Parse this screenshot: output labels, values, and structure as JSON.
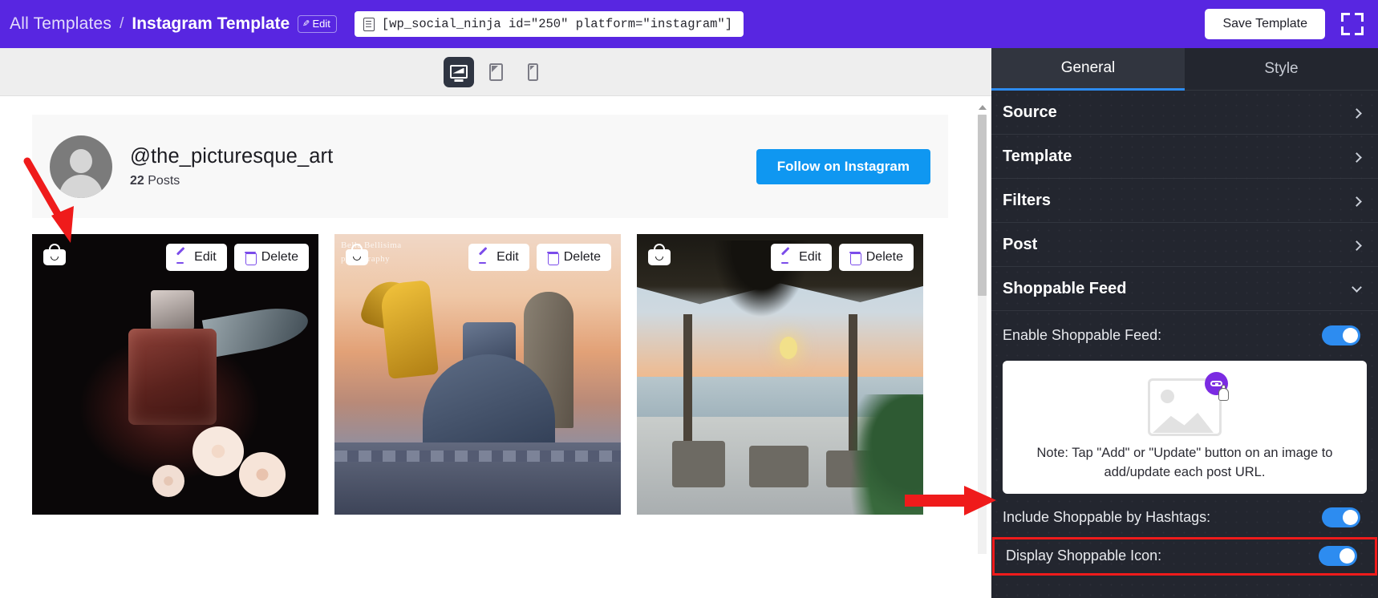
{
  "topbar": {
    "breadcrumb_root": "All Templates",
    "breadcrumb_separator": "/",
    "breadcrumb_current": "Instagram Template",
    "edit_chip_label": "Edit",
    "shortcode": "[wp_social_ninja id=\"250\" platform=\"instagram\"]",
    "save_label": "Save Template",
    "brand_color": "#5826E1"
  },
  "devicebar": {
    "devices": [
      {
        "name": "desktop",
        "active": true
      },
      {
        "name": "tablet",
        "active": false
      },
      {
        "name": "mobile",
        "active": false
      }
    ]
  },
  "preview": {
    "profile": {
      "handle": "@the_picturesque_art",
      "posts_count": "22",
      "posts_label": "Posts",
      "follow_label": "Follow on Instagram",
      "follow_color": "#0f97f1"
    },
    "posts": [
      {
        "alt": "perfume-bottle-dark",
        "shoppable_icon": true,
        "edit_label": "Edit",
        "delete_label": "Delete"
      },
      {
        "alt": "golden-angel-dresden",
        "shoppable_icon": true,
        "edit_label": "Edit",
        "delete_label": "Delete",
        "watermark": "Bella Bellisima\nphotography"
      },
      {
        "alt": "beach-bar-sunset",
        "shoppable_icon": true,
        "edit_label": "Edit",
        "delete_label": "Delete"
      }
    ]
  },
  "panel": {
    "tabs": [
      {
        "label": "General",
        "active": true
      },
      {
        "label": "Style",
        "active": false
      }
    ],
    "accordions": [
      {
        "label": "Source",
        "state": "collapsed"
      },
      {
        "label": "Template",
        "state": "collapsed"
      },
      {
        "label": "Filters",
        "state": "collapsed"
      },
      {
        "label": "Post",
        "state": "collapsed"
      },
      {
        "label": "Shoppable Feed",
        "state": "expanded"
      }
    ],
    "shoppable": {
      "enable_label": "Enable Shoppable Feed:",
      "enable_on": true,
      "note": "Note: Tap \"Add\" or \"Update\" button on an image to add/update each post URL.",
      "hashtags_label": "Include Shoppable by Hashtags:",
      "hashtags_on": true,
      "display_icon_label": "Display Shoppable Icon:",
      "display_icon_on": true,
      "toggle_on_color": "#2d8cf0",
      "highlight_color": "#ef1b1b"
    }
  }
}
